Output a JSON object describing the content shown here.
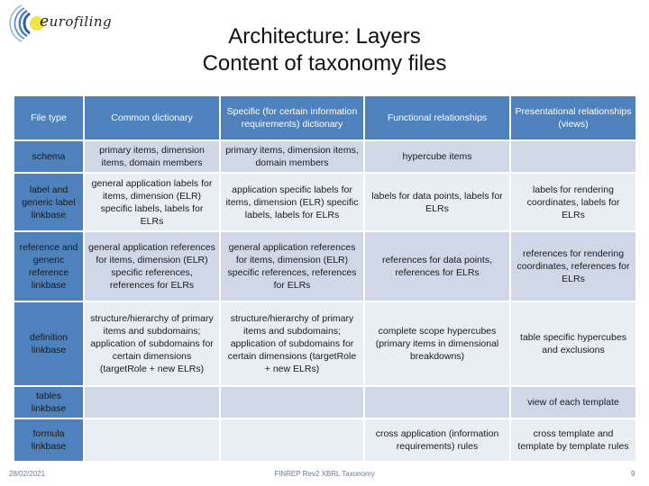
{
  "logo": {
    "text": "urofiling",
    "initial": "e",
    "icon": "eurofiling-logo-icon"
  },
  "title": {
    "line1": "Architecture: Layers",
    "line2": "Content of taxonomy files"
  },
  "table": {
    "headers": [
      "File type",
      "Common dictionary",
      "Specific (for certain information requirements) dictionary",
      "Functional relationships",
      "Presentational relationships (views)"
    ],
    "rows": [
      {
        "file_type": "schema",
        "cells": [
          "primary items, dimension items, domain members",
          "primary items, dimension items, domain members",
          "hypercube items",
          ""
        ]
      },
      {
        "file_type": "label and generic label linkbase",
        "cells": [
          "general application labels for items, dimension (ELR) specific labels, labels for ELRs",
          "application specific labels for items, dimension (ELR) specific labels, labels for ELRs",
          "labels for data points, labels for ELRs",
          "labels for rendering coordinates, labels for ELRs"
        ]
      },
      {
        "file_type": "reference and generic reference linkbase",
        "cells": [
          "general application references for items, dimension (ELR) specific references, references for ELRs",
          "general application references for items, dimension (ELR) specific references, references for ELRs",
          "references for data points, references for ELRs",
          "references for rendering coordinates, references for ELRs"
        ]
      },
      {
        "file_type": "definition linkbase",
        "cells": [
          "structure/hierarchy of primary items and subdomains; application of subdomains for certain dimensions (targetRole + new ELRs)",
          "structure/hierarchy of primary items and subdomains; application of subdomains for certain dimensions (targetRole + new ELRs)",
          "complete scope hypercubes (primary items in dimensional breakdowns)",
          "table specific hypercubes and exclusions"
        ]
      },
      {
        "file_type": "tables linkbase",
        "cells": [
          "",
          "",
          "",
          "view of each template"
        ]
      },
      {
        "file_type": "formula linkbase",
        "cells": [
          "",
          "",
          "cross application (information requirements) rules",
          "cross template and template by template rules"
        ]
      }
    ]
  },
  "footer": {
    "date": "28/02/2021",
    "center": "FINREP Rev2 XBRL Taxonomy",
    "page": "9"
  },
  "colors": {
    "header_blue": "#4f81bd",
    "band_dark": "#d0d8e8",
    "band_light": "#e9edf4",
    "logo_blue": "#2e5f9e",
    "logo_yellow": "#f3e34a"
  }
}
